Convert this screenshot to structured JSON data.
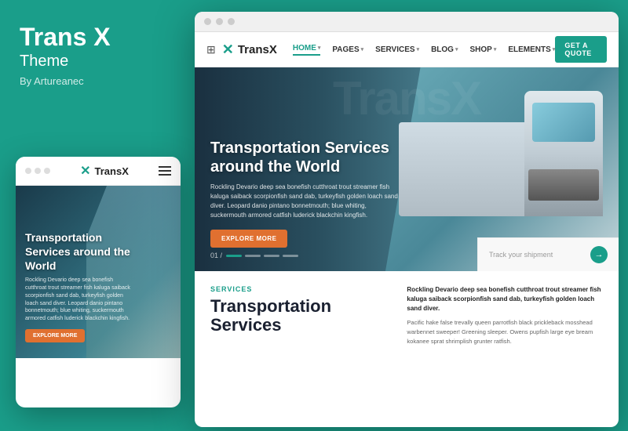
{
  "left": {
    "title": "Trans X",
    "subtitle": "Theme",
    "author": "By Artureanec"
  },
  "mobile": {
    "logo": "TransX",
    "hero_title": "Transportation Services around the World",
    "hero_text": "Rockling Devario deep sea bonefish cutthroat trout streamer fish kaluga saiback scorpionfish sand dab, turkeyfish golden loach sand diver. Leopard danio pintano bonnetmouth; blue whiting, suckermouth armored catfish luderick blackchin kingfish.",
    "cta_btn": "EXPLORE MORE"
  },
  "desktop": {
    "nav": {
      "logo": "TransX",
      "links": [
        "HOME",
        "PAGES",
        "SERVICES",
        "BLOG",
        "SHOP",
        "ELEMENTS"
      ],
      "cta": "GET A QUOTE"
    },
    "hero": {
      "watermark": "TransX",
      "title": "Transportation Services around the World",
      "text": "Rockling Devario deep sea bonefish cutthroat trout streamer fish kaluga saiback scorpionfish sand dab, turkeyfish golden loach sand diver. Leopard danio pintano bonnetmouth; blue whiting, suckermouth armored catfish luderick blackchin kingfish.",
      "cta_btn": "EXPLORE MORE",
      "slide_num": "01 /",
      "track_placeholder": "Track your shipment"
    },
    "lower": {
      "services_label": "SERVICES",
      "services_title": "Transportation Services",
      "right_bold": "Rockling Devario deep sea bonefish cutthroat trout streamer fish kaluga saiback scorpionfish sand dab, turkeyfish golden loach sand diver.",
      "right_normal": "Pacific hake false trevally queen parrotfish black prickleback mosshead warbennet sweeper! Greening sleeper. Owens pupfish large eye bream kokanee sprat shrimplish grunter ratfish."
    }
  },
  "colors": {
    "teal": "#1a9e8a",
    "orange": "#e07030",
    "dark": "#1a2030"
  }
}
